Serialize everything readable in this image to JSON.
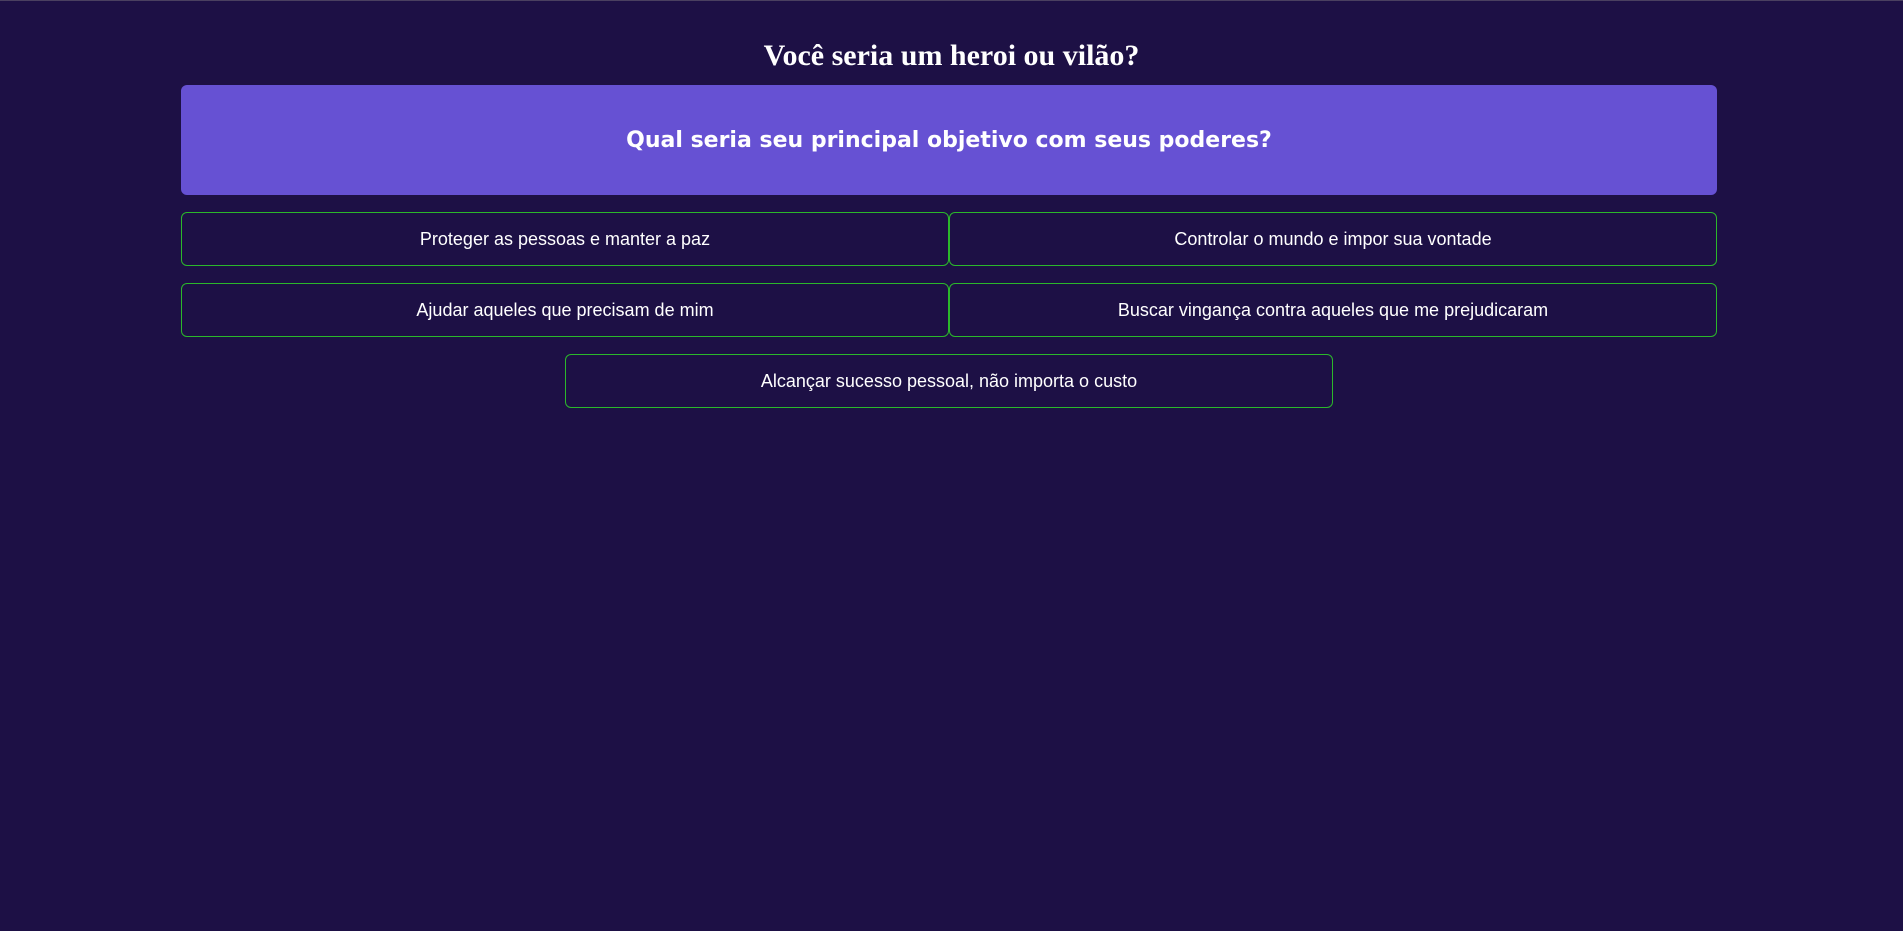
{
  "quiz": {
    "title": "Você seria um heroi ou vilão?",
    "question": "Qual seria seu principal objetivo com seus poderes?",
    "answers": [
      "Proteger as pessoas e manter a paz",
      "Controlar o mundo e impor sua vontade",
      "Ajudar aqueles que precisam de mim",
      "Buscar vingança contra aqueles que me prejudicaram",
      "Alcançar sucesso pessoal, não importa o custo"
    ]
  },
  "colors": {
    "background": "#1d1045",
    "question_box": "#6651d3",
    "answer_border": "#2bb82b",
    "text": "#ffffff"
  }
}
